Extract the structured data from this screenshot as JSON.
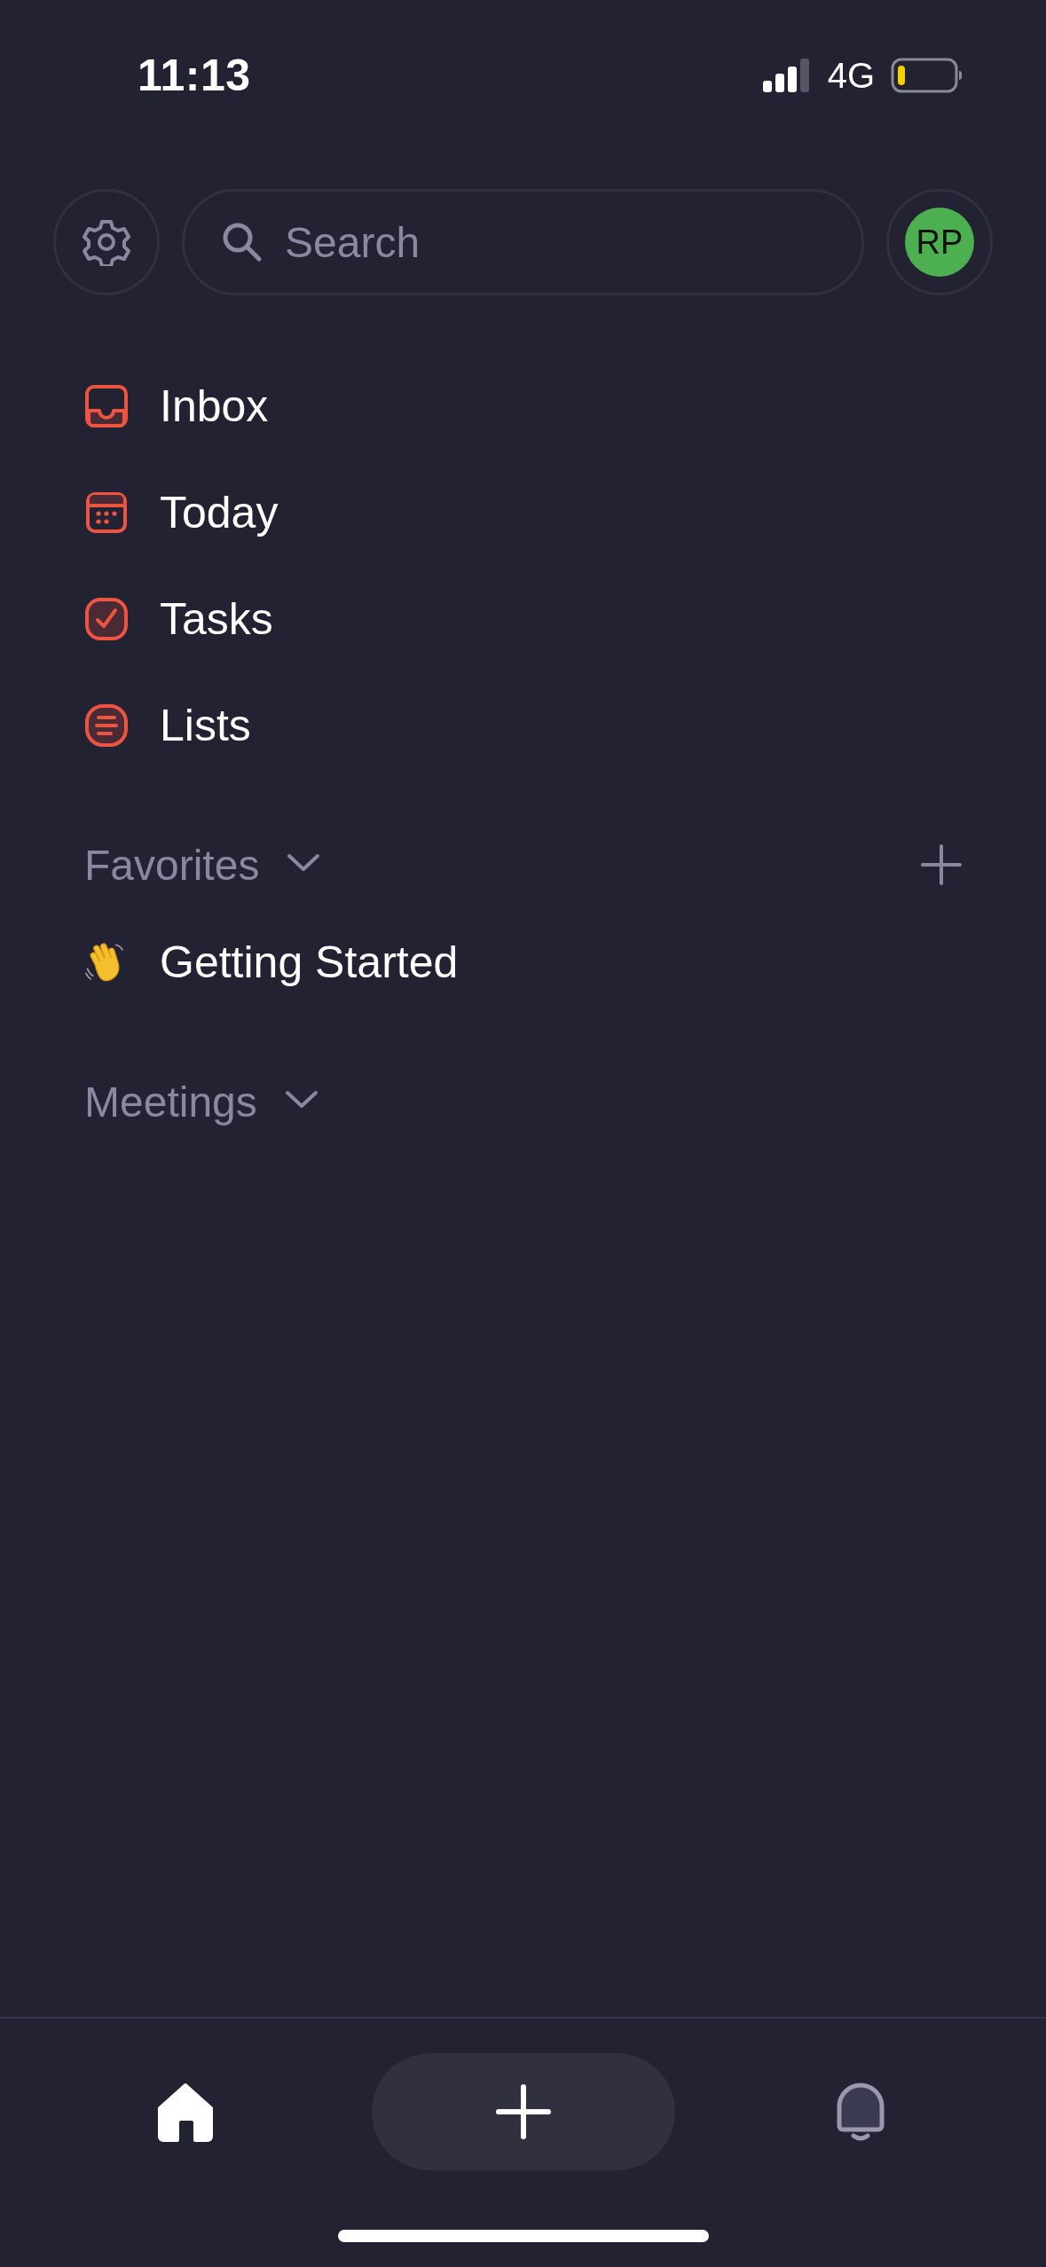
{
  "status_bar": {
    "time": "11:13",
    "network": "4G"
  },
  "search": {
    "placeholder": "Search"
  },
  "avatar": {
    "initials": "RP",
    "color": "#4caf50"
  },
  "nav_items": [
    {
      "kind": "inbox",
      "label": "Inbox"
    },
    {
      "kind": "calendar",
      "label": "Today"
    },
    {
      "kind": "check",
      "label": "Tasks"
    },
    {
      "kind": "list",
      "label": "Lists"
    }
  ],
  "sections": [
    {
      "title": "Favorites",
      "expanded": true,
      "add_button": true,
      "items": [
        {
          "kind": "wave",
          "label": "Getting Started"
        }
      ]
    },
    {
      "title": "Meetings",
      "expanded": true,
      "add_button": false
    }
  ],
  "tab_bar": [
    {
      "kind": "home",
      "selected": true
    },
    {
      "kind": "add"
    },
    {
      "kind": "bell",
      "selected": false
    }
  ]
}
